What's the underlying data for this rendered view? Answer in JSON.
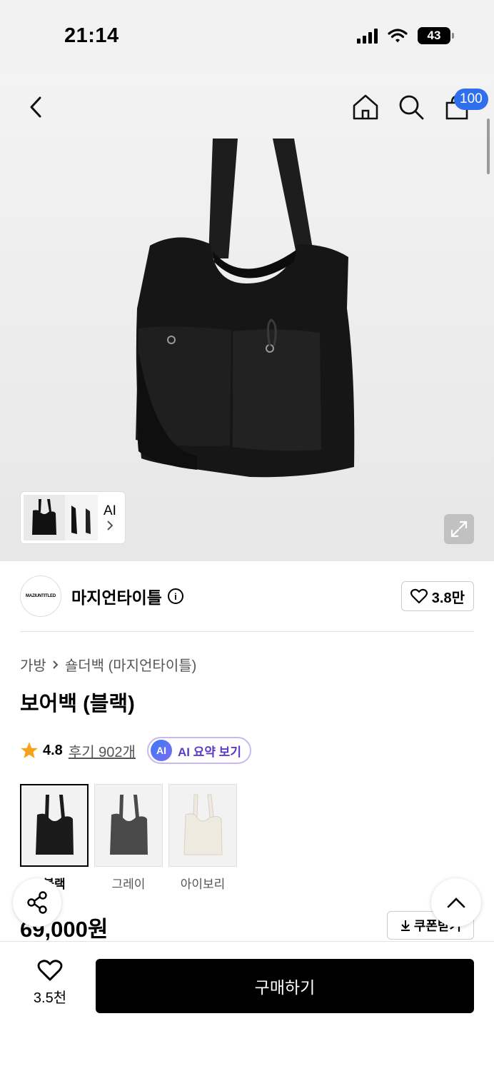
{
  "status_bar": {
    "time": "21:14",
    "battery": "43"
  },
  "header": {
    "cart_count": "100"
  },
  "gallery": {
    "ai_label": "AI"
  },
  "brand": {
    "name": "마지언타이틀",
    "logo_text": "MAZIUNTITLED",
    "like_count": "3.8만"
  },
  "breadcrumb": {
    "category": "가방",
    "subcategory": "숄더백 (마지언타이틀)"
  },
  "product": {
    "title": "보어백 (블랙)",
    "price": "69,000원"
  },
  "rating": {
    "score": "4.8",
    "reviews": "후기 902개",
    "ai_summary": "AI 요약 보기",
    "ai_badge": "AI"
  },
  "colors": [
    {
      "label": "블랙",
      "swatch": "#1a1a1a",
      "selected": true
    },
    {
      "label": "그레이",
      "swatch": "#4a4a4a",
      "selected": false
    },
    {
      "label": "아이보리",
      "swatch": "#efeae0",
      "selected": false
    }
  ],
  "coupon": {
    "label": "쿠폰받기"
  },
  "bottom_bar": {
    "wish_count": "3.5천",
    "buy_label": "구매하기"
  },
  "icons": [
    "back-icon",
    "home-icon",
    "search-icon",
    "cart-icon",
    "expand-icon",
    "info-icon",
    "heart-icon",
    "star-icon",
    "share-icon",
    "chevron-up-icon",
    "download-icon"
  ]
}
